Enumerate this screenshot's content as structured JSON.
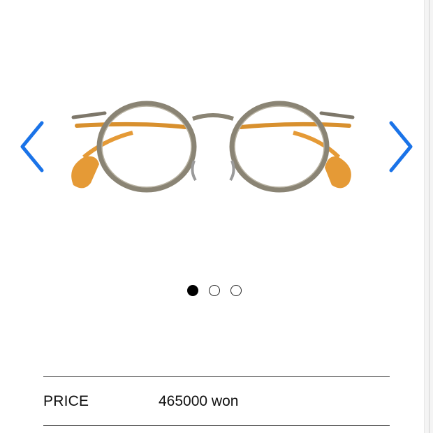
{
  "carousel": {
    "prev_icon": "chevron-left-icon",
    "next_icon": "chevron-right-icon",
    "accent_color": "#1a73e8",
    "slide_count": 3,
    "active_slide": 1
  },
  "product": {
    "image": "round-metal-eyeglasses-antique-gold-frame-amber-temple-tips",
    "frame_color": "#8a8474",
    "temple_tip_color": "#e8a33a"
  },
  "details": {
    "price_label": "PRICE",
    "price_value": "465000 won"
  }
}
